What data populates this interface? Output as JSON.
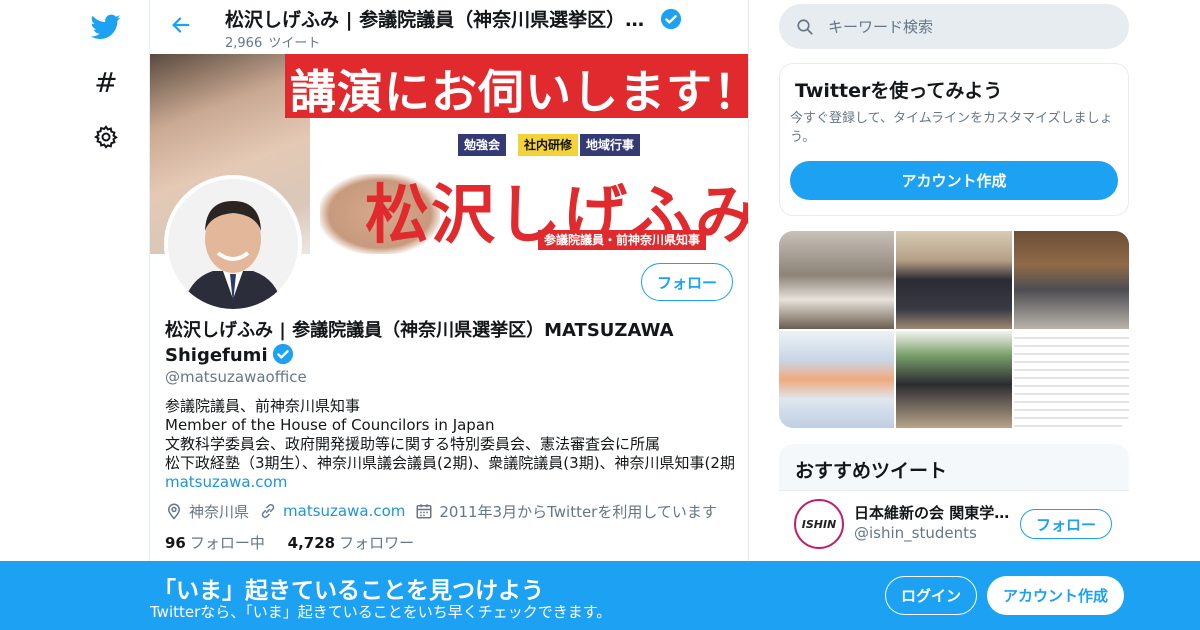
{
  "nav": {
    "items": [
      {
        "icon": "twitter-bird-icon"
      },
      {
        "icon": "hashtag-icon",
        "glyph": "#"
      },
      {
        "icon": "gear-icon"
      }
    ]
  },
  "header": {
    "title": "松沢しげふみ | 参議院議員（神奈川県選挙区）MATSUZAWA Shigefumi",
    "tweet_count": "2,966",
    "tweet_label": "ツイート"
  },
  "banner": {
    "headline": "講演にお伺いします！",
    "tags": [
      "勉強会",
      "社内研修",
      "地域行事"
    ],
    "name": "松沢しげふみ",
    "subtitle": "参議院議員・前神奈川県知事"
  },
  "profile": {
    "follow_label": "フォロー",
    "name": "松沢しげふみ | 参議院議員（神奈川県選挙区）MATSUZAWA Shigefumi",
    "handle": "@matsuzawaoffice",
    "bio_lines": [
      "参議院議員、前神奈川県知事",
      "Member of the House of Councilors in Japan",
      "文教科学委員会、政府開発援助等に関する特別委員会、憲法審査会に所属",
      "松下政経塾（3期生）、神奈川県議会議員(2期)、衆議院議員(3期)、神奈川県知事(2期"
    ],
    "bio_link": "matsuzawa.com",
    "location": "神奈川県",
    "website": "matsuzawa.com",
    "joined": "2011年3月からTwitterを利用しています",
    "following_count": "96",
    "following_label": "フォロー中",
    "followers_count": "4,728",
    "followers_label": "フォロワー"
  },
  "search": {
    "placeholder": "キーワード検索"
  },
  "signup_card": {
    "title": "Twitterを使ってみよう",
    "description": "今すぐ登録して、タイムラインをカスタマイズしましょう。",
    "button": "アカウント作成"
  },
  "recommended": {
    "title": "おすすめツイート",
    "item": {
      "name": "日本維新の会 関東学生局",
      "handle": "@ishin_students",
      "avatar_text": "ISHIN",
      "follow_label": "フォロー"
    }
  },
  "bottom_bar": {
    "title": "「いま」起きていることを見つけよう",
    "subtitle": "Twitterなら、「いま」起きていることをいち早くチェックできます。",
    "login": "ログイン",
    "signup": "アカウント作成"
  },
  "colors": {
    "accent": "#1da1f2",
    "banner_red": "#e12a2d",
    "text_secondary": "#657786",
    "link": "#1b95e0"
  }
}
